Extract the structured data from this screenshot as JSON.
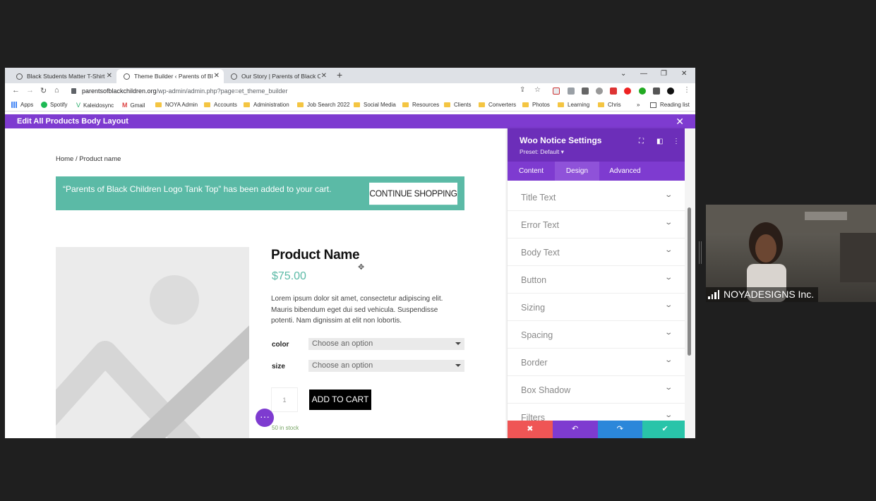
{
  "tabs": [
    {
      "title": "Black Students Matter T-Shirt | Pa",
      "active": false
    },
    {
      "title": "Theme Builder ‹ Parents of Black C",
      "active": true
    },
    {
      "title": "Our Story | Parents of Black Childr",
      "active": false
    }
  ],
  "address": {
    "host": "parentsofblackchildren.org",
    "path": "/wp-admin/admin.php?page=et_theme_builder"
  },
  "bookmarks": [
    {
      "label": "Apps",
      "kind": "apps"
    },
    {
      "label": "Spotify",
      "kind": "spotify"
    },
    {
      "label": "Kaleidosync",
      "kind": "kaleidosync"
    },
    {
      "label": "Gmail",
      "kind": "gmail"
    },
    {
      "label": "NOYA Admin",
      "kind": "folder"
    },
    {
      "label": "Accounts",
      "kind": "folder"
    },
    {
      "label": "Administration",
      "kind": "folder"
    },
    {
      "label": "Job Search 2022",
      "kind": "folder"
    },
    {
      "label": "Social Media",
      "kind": "folder"
    },
    {
      "label": "Resources",
      "kind": "folder"
    },
    {
      "label": "Clients",
      "kind": "folder"
    },
    {
      "label": "Converters",
      "kind": "folder"
    },
    {
      "label": "Photos",
      "kind": "folder"
    },
    {
      "label": "Learning",
      "kind": "folder"
    },
    {
      "label": "Chris",
      "kind": "folder"
    }
  ],
  "bookmarks_overflow": "»",
  "reading_list": "Reading list",
  "builder_bar": {
    "title": "Edit All Products Body Layout"
  },
  "page": {
    "breadcrumb": "Home / Product name",
    "notice": {
      "message": "“Parents of Black Children Logo Tank Top” has been added to your cart.",
      "button": "CONTINUE SHOPPING"
    },
    "product": {
      "name": "Product Name",
      "price": "$75.00",
      "description": "Lorem ipsum dolor sit amet, consectetur adipiscing elit. Mauris bibendum eget dui sed vehicula. Suspendisse potenti. Nam dignissim at elit non lobortis.",
      "variations": [
        {
          "label": "color",
          "placeholder": "Choose an option"
        },
        {
          "label": "size",
          "placeholder": "Choose an option"
        }
      ],
      "quantity": "1",
      "add_to_cart": "ADD TO CART",
      "stock": "50 in stock"
    }
  },
  "panel": {
    "title": "Woo Notice Settings",
    "preset": "Preset: Default ▾",
    "tabs": [
      "Content",
      "Design",
      "Advanced"
    ],
    "active_tab": "Design",
    "sections": [
      "Title Text",
      "Error Text",
      "Body Text",
      "Button",
      "Sizing",
      "Spacing",
      "Border",
      "Box Shadow",
      "Filters"
    ],
    "footer_colors": {
      "cancel": "#ef5555",
      "undo": "#7e3bd0",
      "redo": "#2b87da",
      "save": "#29c4a9"
    }
  },
  "video": {
    "participant": "NOYADESIGNS Inc."
  },
  "colors": {
    "divi_purple": "#7e3bd0",
    "notice_teal": "#5bbaa6",
    "price_teal": "#5bbaa6"
  }
}
